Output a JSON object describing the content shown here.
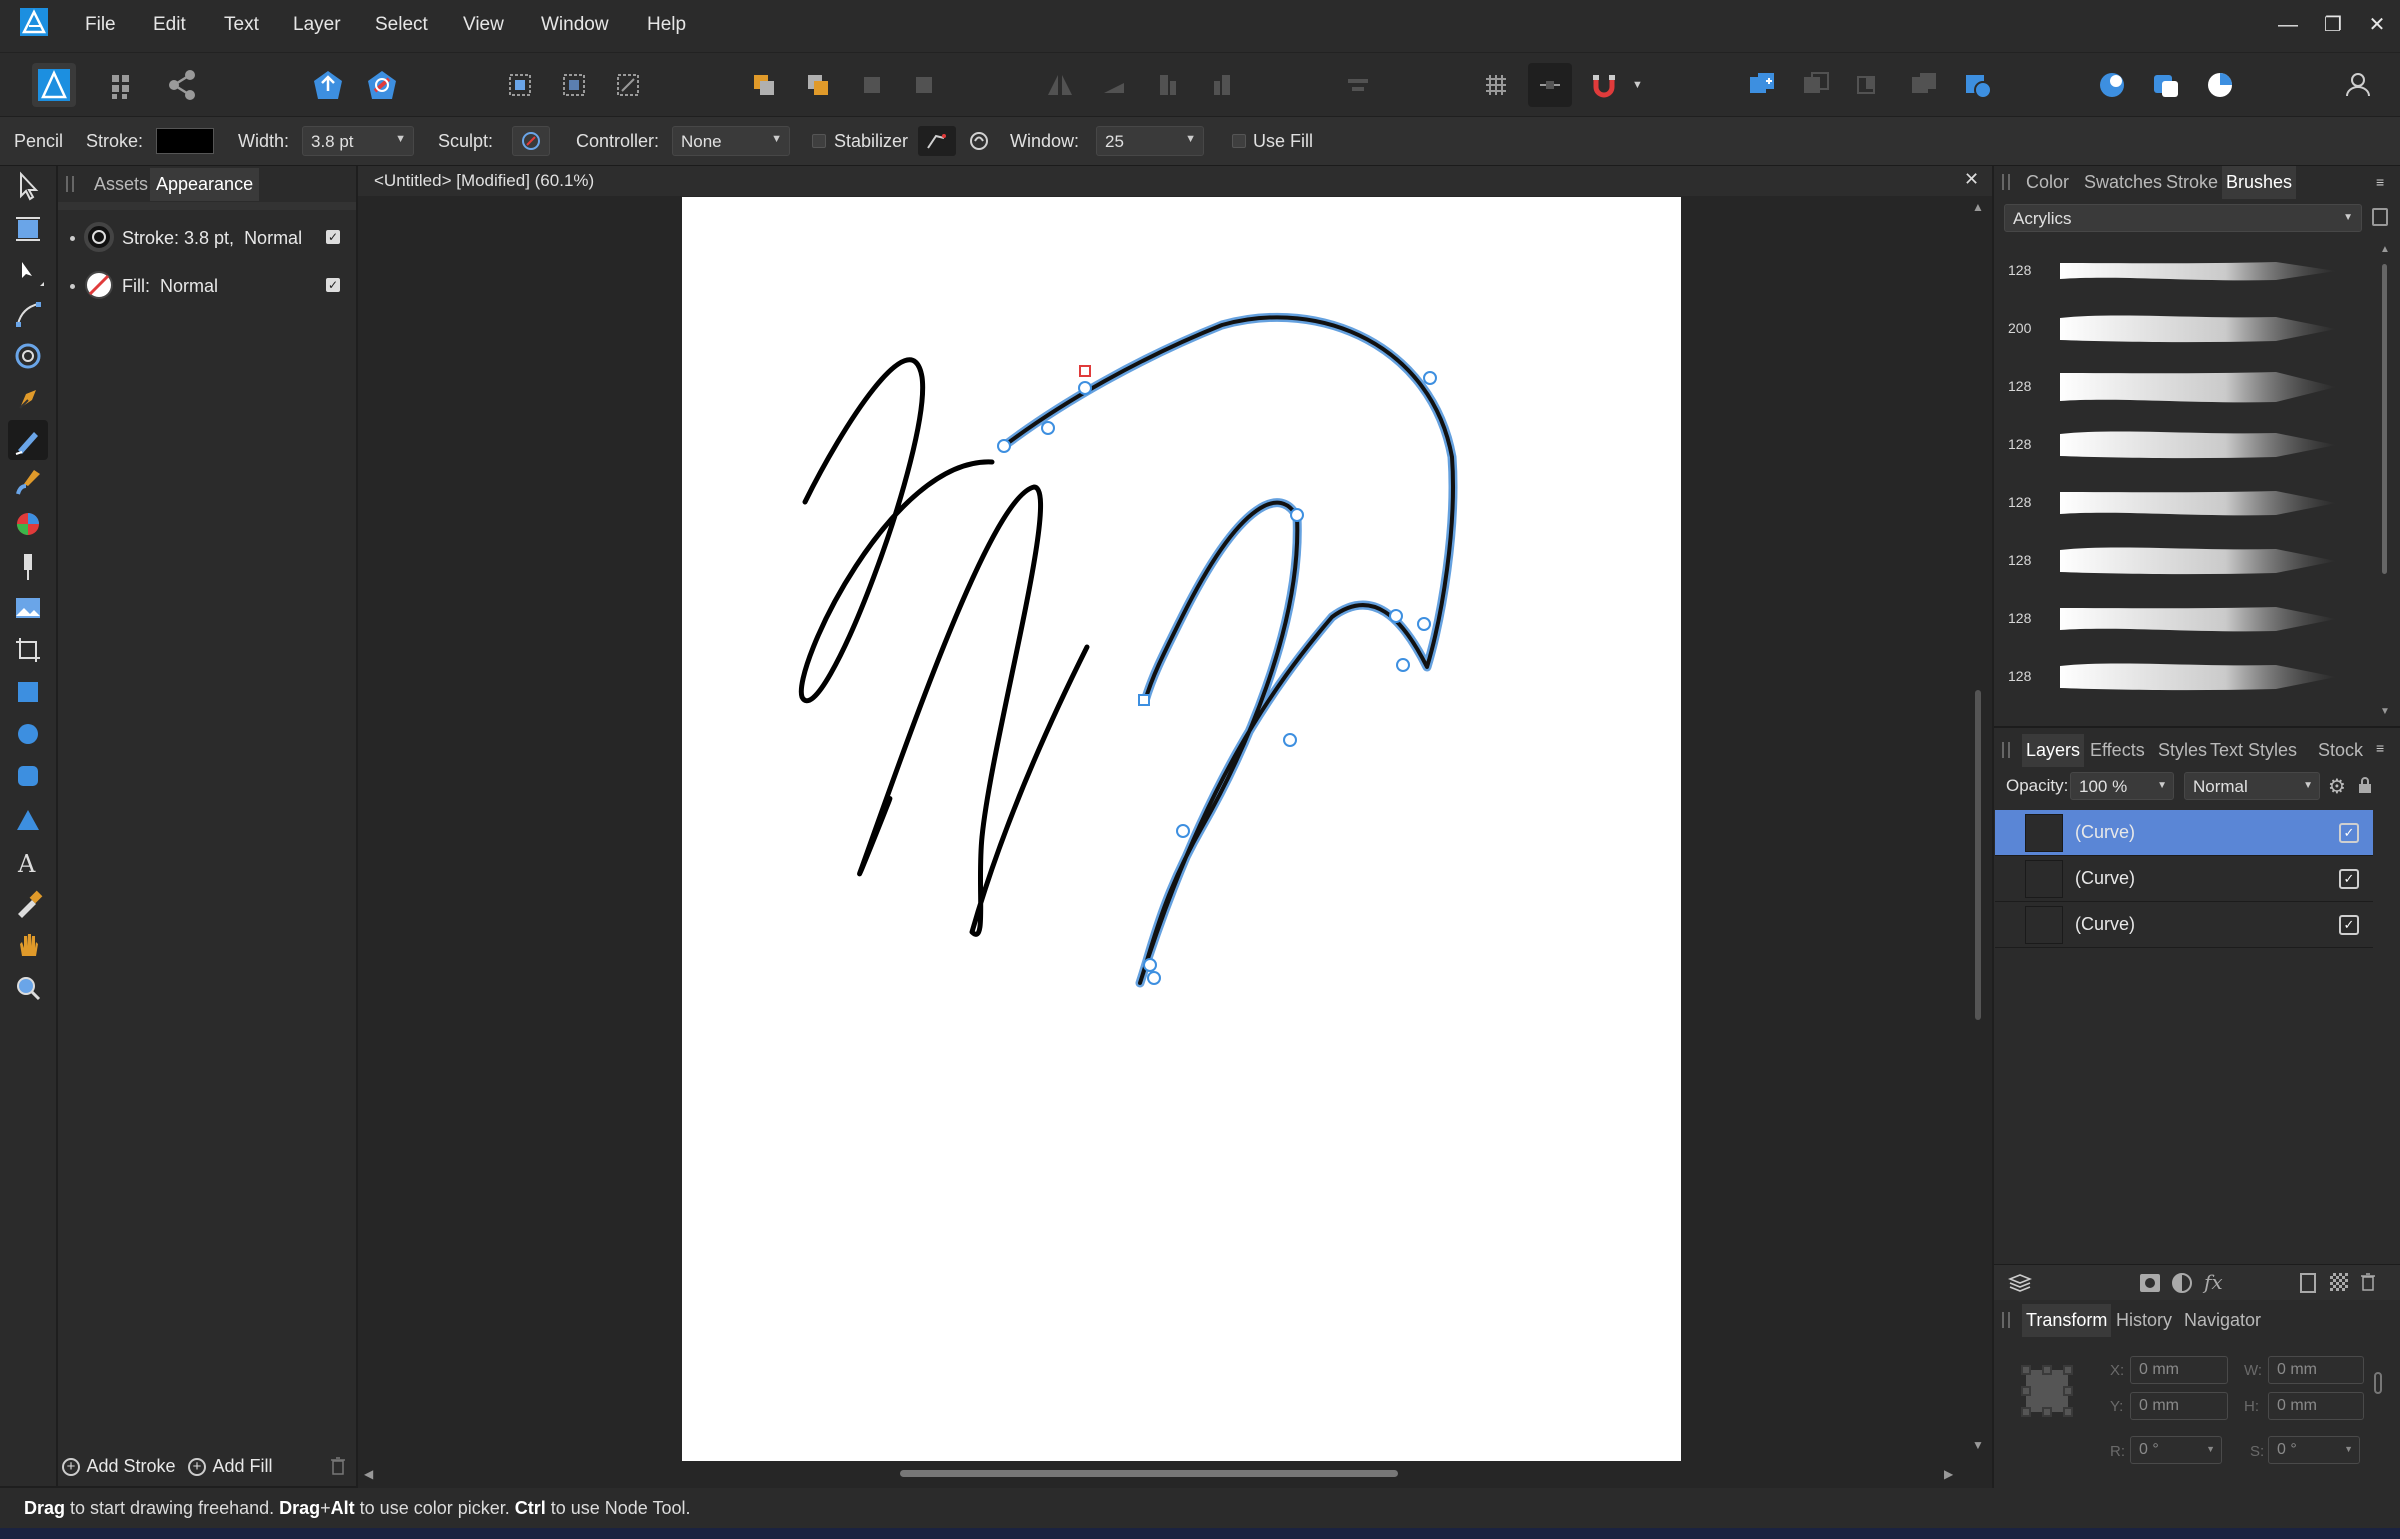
{
  "menu": {
    "items": [
      "File",
      "Edit",
      "Text",
      "Layer",
      "Select",
      "View",
      "Window",
      "Help"
    ]
  },
  "window_controls": {
    "minimize": "—",
    "restore": "❐",
    "close": "✕"
  },
  "context_bar": {
    "tool_name": "Pencil",
    "stroke_label": "Stroke:",
    "stroke_color": "#000000",
    "width_label": "Width:",
    "width_value": "3.8 pt",
    "sculpt_label": "Sculpt:",
    "controller_label": "Controller:",
    "controller_value": "None",
    "stabilizer_label": "Stabilizer",
    "window_label": "Window:",
    "window_value": "25",
    "use_fill_label": "Use Fill"
  },
  "left_panel": {
    "tabs": [
      "Assets",
      "Appearance"
    ],
    "active_tab": "Appearance",
    "stroke_row": "Stroke: 3.8 pt,  Normal",
    "fill_row": "Fill:  Normal",
    "add_stroke": "Add Stroke",
    "add_fill": "Add Fill"
  },
  "document": {
    "title": "<Untitled> [Modified] (60.1%)"
  },
  "brushes_panel": {
    "tabs": [
      "Color",
      "Swatches",
      "Stroke",
      "Brushes"
    ],
    "active_tab": "Brushes",
    "category": "Acrylics",
    "brush_sizes": [
      "128",
      "200",
      "128",
      "128",
      "128",
      "128",
      "128",
      "128"
    ]
  },
  "layers_panel": {
    "tabs": [
      "Layers",
      "Effects",
      "Styles",
      "Text Styles",
      "Stock"
    ],
    "active_tab": "Layers",
    "opacity_label": "Opacity:",
    "opacity_value": "100 %",
    "blend_mode": "Normal",
    "layers": [
      {
        "name": "(Curve)",
        "selected": true
      },
      {
        "name": "(Curve)",
        "selected": false
      },
      {
        "name": "(Curve)",
        "selected": false
      }
    ]
  },
  "transform_panel": {
    "tabs": [
      "Transform",
      "History",
      "Navigator"
    ],
    "active_tab": "Transform",
    "x_label": "X:",
    "x_value": "0 mm",
    "y_label": "Y:",
    "y_value": "0 mm",
    "w_label": "W:",
    "w_value": "0 mm",
    "h_label": "H:",
    "h_value": "0 mm",
    "r_label": "R:",
    "r_value": "0 °",
    "s_label": "S:",
    "s_value": "0 °"
  },
  "status_bar": {
    "drag": "Drag",
    "part1": " to start drawing freehand. ",
    "drag_alt": "Drag",
    "plus": "+",
    "alt": "Alt",
    "part2": " to use color picker. ",
    "ctrl": "Ctrl",
    "part3": " to use Node Tool."
  },
  "colors": {
    "accent_blue": "#3d8fe0",
    "selection_blue": "#5a86d6",
    "path_highlight": "#4a90d9",
    "warning_red": "#e03b3b"
  }
}
